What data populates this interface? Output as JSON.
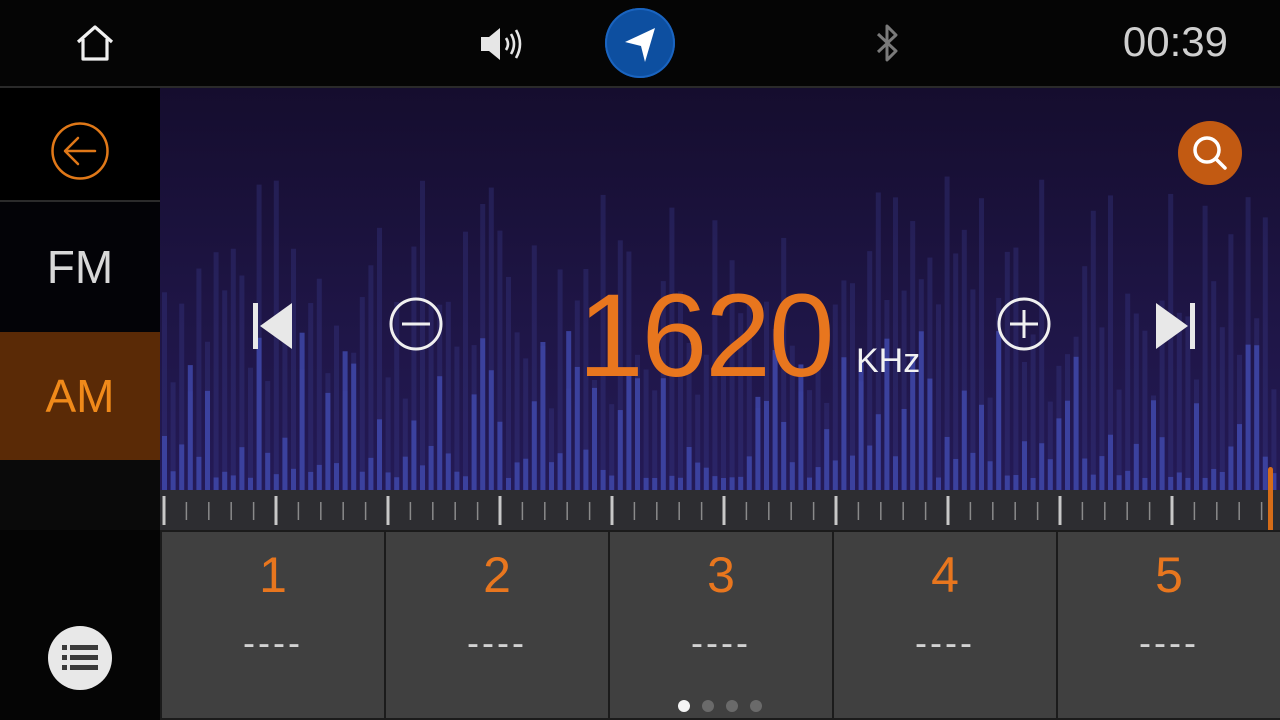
{
  "status_bar": {
    "clock": "00:39",
    "icons": [
      "home-icon",
      "volume-icon",
      "navigation-icon",
      "bluetooth-icon"
    ]
  },
  "sidebar": {
    "back_icon": "back-arrow-icon",
    "bands": [
      {
        "label": "FM",
        "selected": false
      },
      {
        "label": "AM",
        "selected": true
      }
    ],
    "list_icon": "list-icon"
  },
  "tuner": {
    "frequency": "1620",
    "unit": "KHz",
    "controls": [
      "previous-station-icon",
      "minus-icon",
      "plus-icon",
      "next-station-icon"
    ],
    "search_icon": "search-icon"
  },
  "presets": [
    {
      "number": "1",
      "name": "----"
    },
    {
      "number": "2",
      "name": "----"
    },
    {
      "number": "3",
      "name": "----"
    },
    {
      "number": "4",
      "name": "----"
    },
    {
      "number": "5",
      "name": "----"
    }
  ],
  "pagination": {
    "pages": 4,
    "current": 1
  },
  "colors": {
    "accent": "#e8761e",
    "nav_button": "#0d4fa0",
    "am_highlight": "#5a2a06",
    "panel_background": "#1e1545"
  }
}
